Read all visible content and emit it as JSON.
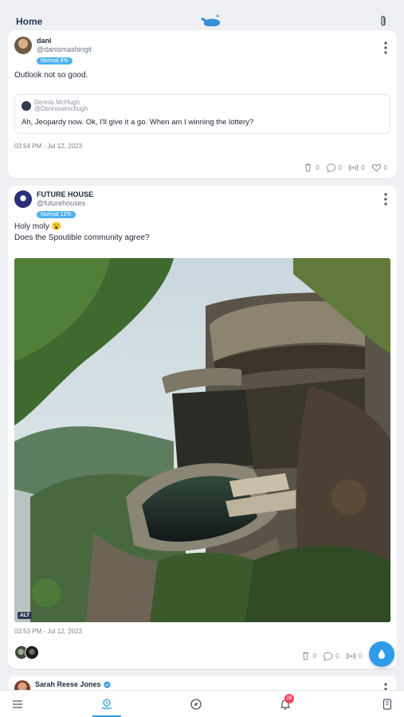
{
  "header": {
    "title": "Home",
    "logo_icon": "whale-logo-icon",
    "attach_icon": "paperclip-icon"
  },
  "colors": {
    "accent": "#2d9be8",
    "badge": "#4fb1ef",
    "notification": "#f0475e"
  },
  "posts": [
    {
      "name": "dani",
      "handle": "@danismashingit",
      "badge": "Normal 8%",
      "text": "Outlook not so good.",
      "quote": {
        "name": "Dennis McHugh",
        "handle": "@Denniswmchugh",
        "text": "Ah, Jeopardy now. Ok, I'll give it a go. When am I winning the lottery?"
      },
      "timestamp": "03:54 PM - Jul 12, 2023",
      "actions": {
        "trash": "0",
        "comment": "0",
        "broadcast": "0",
        "likes": "0"
      }
    },
    {
      "name": "FUTURE HOUSE",
      "handle": "@futurehouses",
      "badge": "Normal 12%",
      "text_line1": "Holy moly 😮",
      "text_line2": "Does the Spoutible community agree?",
      "image_alt": "ALT",
      "timestamp": "03:53 PM - Jul 12, 2023",
      "actions": {
        "trash": "0",
        "comment": "0",
        "broadcast": "0"
      }
    },
    {
      "name": "Sarah Reese Jones"
    }
  ],
  "tabbar": {
    "active": "home",
    "notification_count": "28"
  }
}
